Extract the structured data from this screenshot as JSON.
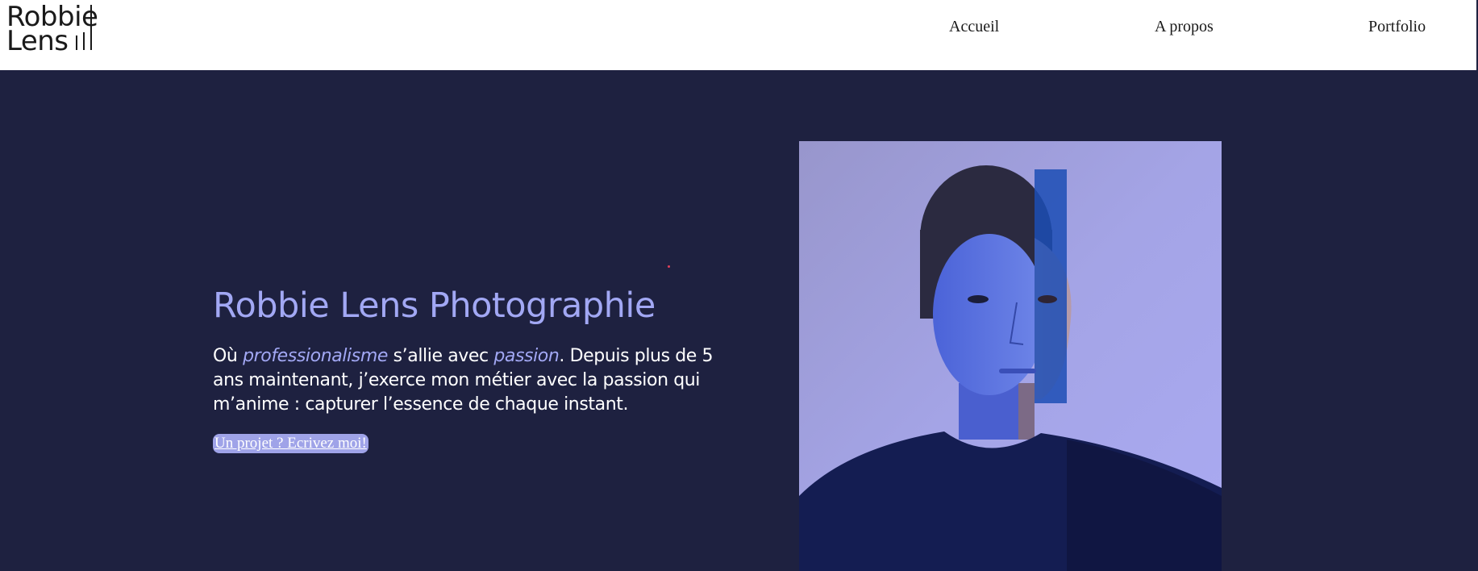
{
  "logo": {
    "line1": "Robbie",
    "line2": "Lens"
  },
  "nav": [
    {
      "label": "Accueil"
    },
    {
      "label": "A propos"
    },
    {
      "label": "Portfolio"
    }
  ],
  "hero": {
    "title": "Robbie Lens Photographie",
    "desc": {
      "p1": "Où ",
      "em1": "professionalisme",
      "p2": " s’allie avec ",
      "em2": "passion",
      "p3": ". Depuis plus de 5 ans maintenant, j’exerce mon métier avec la passion qui m’anime : capturer l’essence de chaque instant."
    },
    "cta": "Un projet ? Ecrivez moi!"
  },
  "colors": {
    "background": "#1e2140",
    "accent": "#a2a8f4",
    "header": "#ffffff",
    "cta": "#9fa3e8"
  }
}
